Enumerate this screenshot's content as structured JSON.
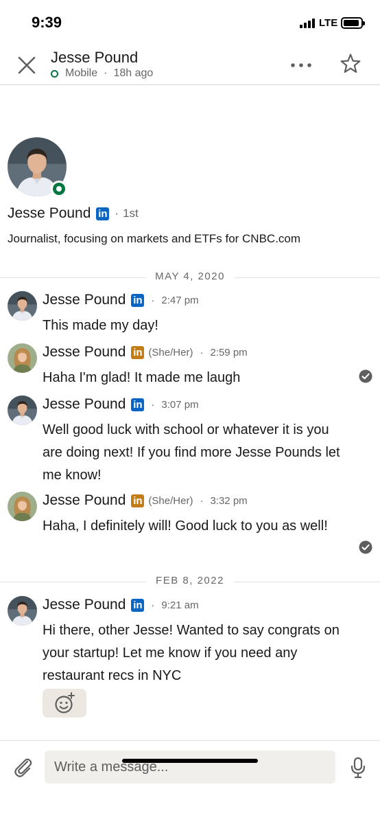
{
  "status_bar": {
    "time": "9:39",
    "network": "LTE"
  },
  "header": {
    "name": "Jesse Pound",
    "device": "Mobile",
    "separator": "·",
    "last_active": "18h ago",
    "icons": {
      "close": "close-icon",
      "more": "more-icon",
      "star": "star-icon"
    }
  },
  "profile": {
    "name": "Jesse Pound",
    "badge": "in",
    "separator": "·",
    "degree": "1st",
    "headline": "Journalist, focusing on markets and ETFs for CNBC.com"
  },
  "dividers": [
    "MAY 4, 2020",
    "FEB 8, 2022"
  ],
  "messages": [
    {
      "name": "Jesse Pound",
      "badge": "in",
      "pronouns": "",
      "separator": "·",
      "time": "2:47 pm",
      "text": "This made my day!"
    },
    {
      "name": "Jesse Pound",
      "badge": "in",
      "pronouns": "(She/Her)",
      "separator": "·",
      "time": "2:59 pm",
      "text": "Haha I'm glad! It made me laugh"
    },
    {
      "name": "Jesse Pound",
      "badge": "in",
      "pronouns": "",
      "separator": "·",
      "time": "3:07 pm",
      "text": "Well good luck with school or whatever it is you are doing next! If you find more Jesse Pounds let me know!"
    },
    {
      "name": "Jesse Pound",
      "badge": "in",
      "pronouns": "(She/Her)",
      "separator": "·",
      "time": "3:32 pm",
      "text": "Haha, I definitely will! Good luck to you as well!"
    },
    {
      "name": "Jesse Pound",
      "badge": "in",
      "pronouns": "",
      "separator": "·",
      "time": "9:21 am",
      "text": "Hi there, other Jesse! Wanted to say congrats on your startup! Let me know if you need any restaurant recs in NYC"
    }
  ],
  "composer": {
    "placeholder": "Write a message..."
  },
  "colors": {
    "online_green": "#057642",
    "linkedin_blue": "#0a66c2",
    "premium_gold": "#c37d16",
    "seen_gray": "#5e5e5e"
  }
}
